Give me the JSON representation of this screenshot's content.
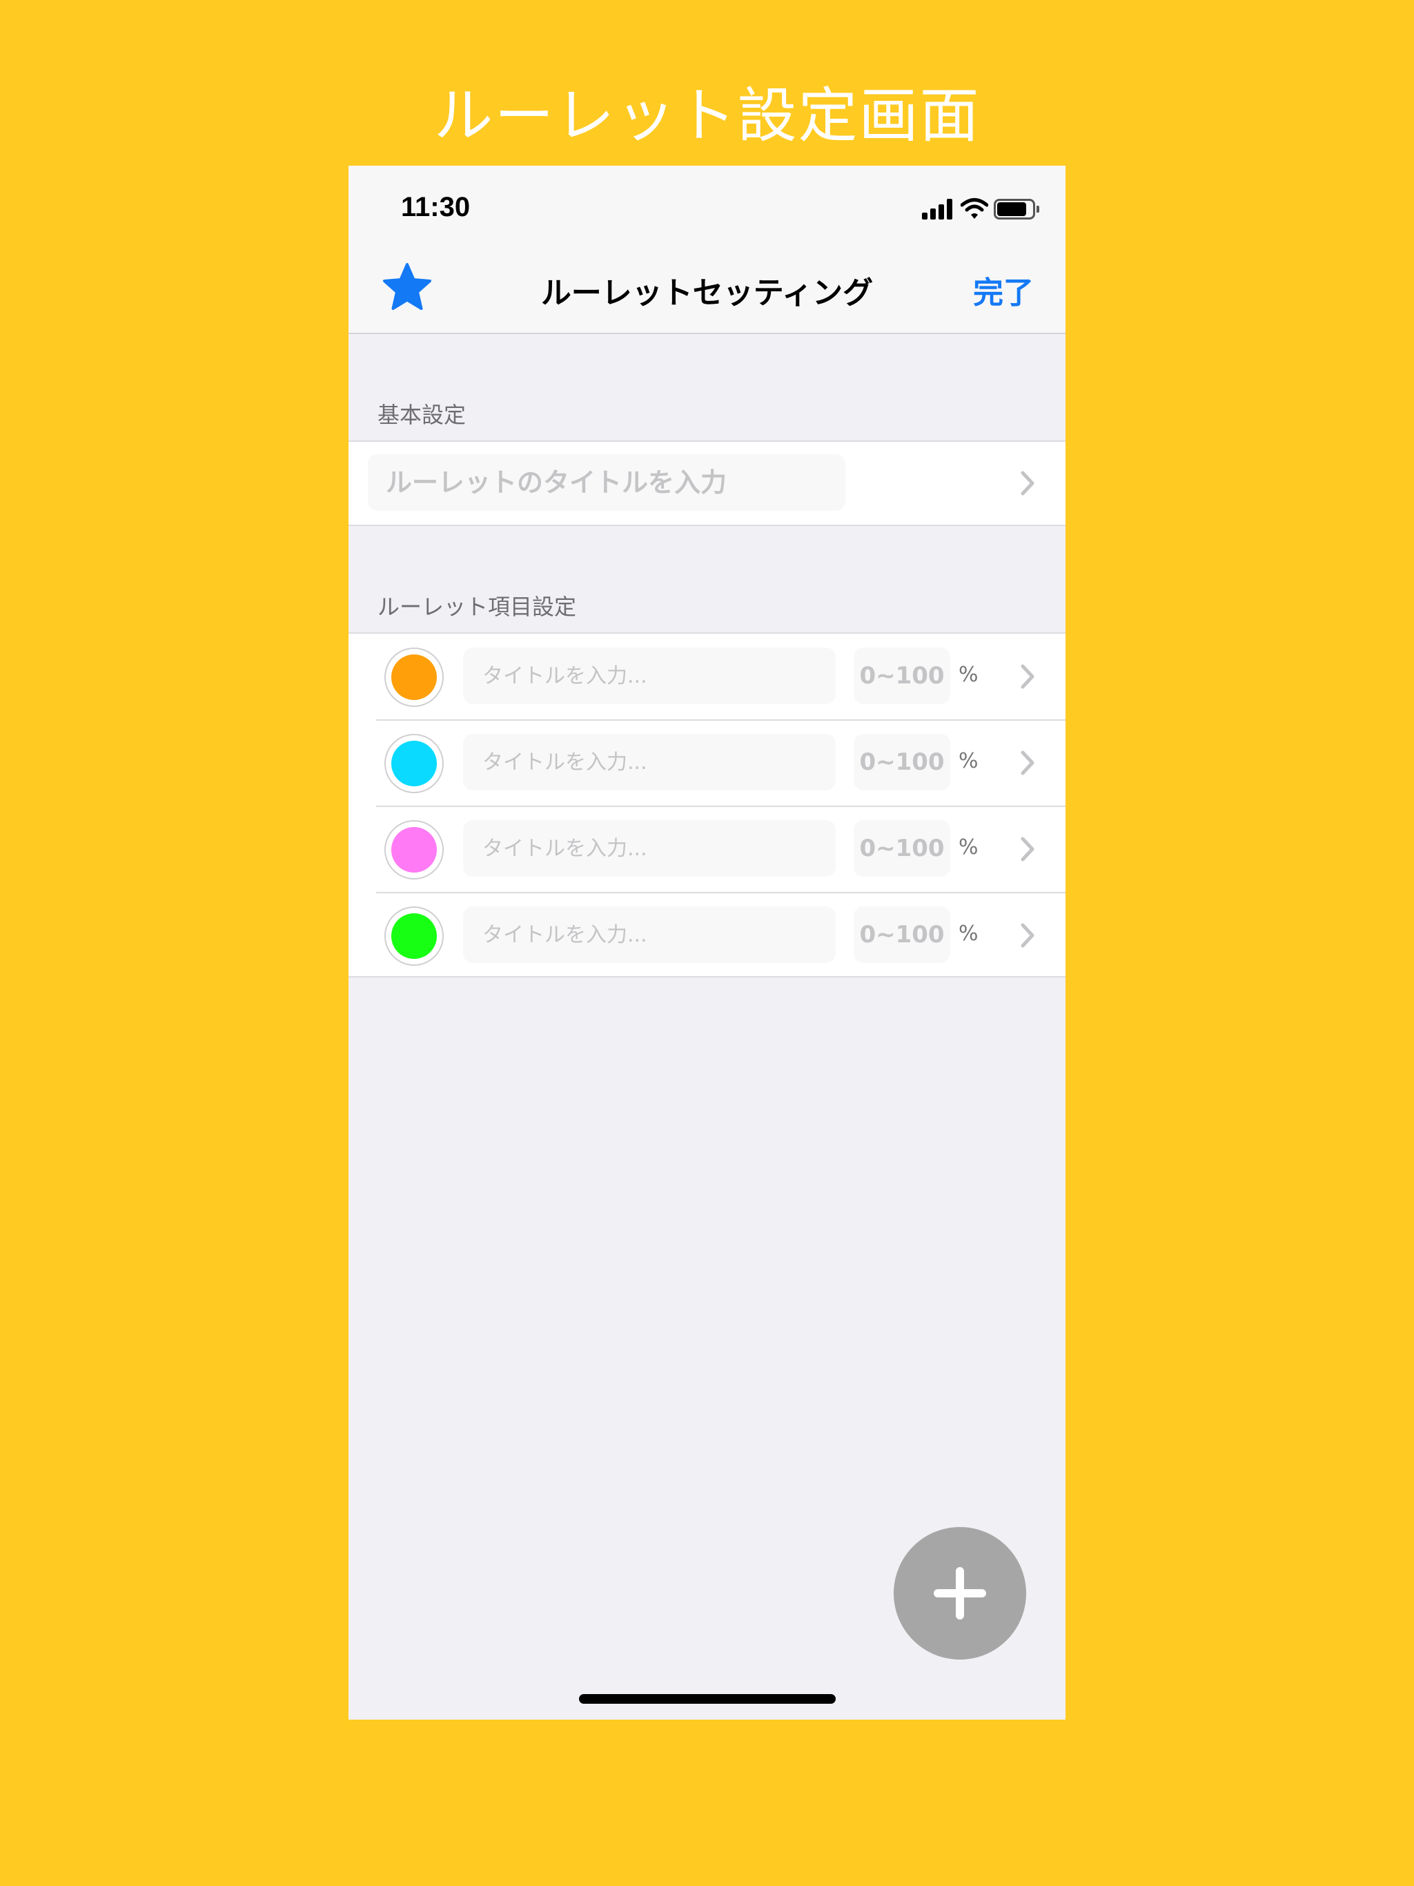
{
  "promo": {
    "title": "ルーレット設定画面"
  },
  "status_bar": {
    "time": "11:30",
    "icons": [
      "signal-icon",
      "wifi-icon",
      "battery-icon"
    ]
  },
  "nav": {
    "left_icon": "star-icon",
    "title": "ルーレットセッティング",
    "done_label": "完了"
  },
  "sections": {
    "basic": {
      "header": "基本設定",
      "title_placeholder": "ルーレットのタイトルを入力"
    },
    "items": {
      "header": "ルーレット項目設定",
      "rows": [
        {
          "color": "#FF9F0A",
          "title_placeholder": "タイトルを入力...",
          "percent_placeholder": "0~100",
          "unit": "%"
        },
        {
          "color": "#0ADAFF",
          "title_placeholder": "タイトルを入力...",
          "percent_placeholder": "0~100",
          "unit": "%"
        },
        {
          "color": "#FF7AF4",
          "title_placeholder": "タイトルを入力...",
          "percent_placeholder": "0~100",
          "unit": "%"
        },
        {
          "color": "#17FF12",
          "title_placeholder": "タイトルを入力...",
          "percent_placeholder": "0~100",
          "unit": "%"
        }
      ]
    }
  },
  "fab": {
    "icon": "plus-icon"
  },
  "colors": {
    "background": "#FFCA22",
    "accent": "#1479F5",
    "fab": "#A6A6A6",
    "screen": "#F1F1F5"
  }
}
